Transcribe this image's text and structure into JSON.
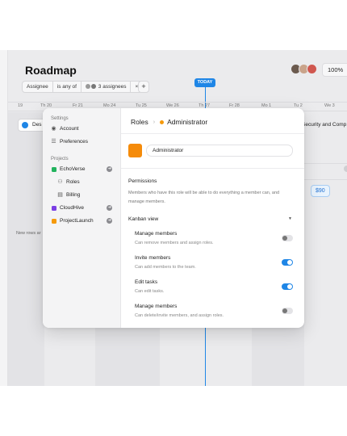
{
  "app": {
    "title": "Roadmap",
    "zoom": "100%",
    "filter": {
      "field": "Assignee",
      "operator": "is any of",
      "value": "3 assignees",
      "clear": "×"
    },
    "add_filter": "+",
    "today_label": "TODAY",
    "days": [
      "19",
      "Th 20",
      "Fr 21",
      "Mo 24",
      "Tu 25",
      "We 26",
      "Th 27",
      "Fr 28",
      "Mo 1",
      "Tu 2",
      "We 3"
    ],
    "task_left": "Des",
    "task_right": "Security and Comp",
    "price": "$90",
    "add_row": "+",
    "new_rows_note": "New rows ar"
  },
  "modal": {
    "settings_header": "Settings",
    "account": "Account",
    "preferences": "Preferences",
    "projects_header": "Projects",
    "projects": [
      {
        "name": "EchoVerse",
        "color": "#22b35e"
      },
      {
        "name": "CloudHive",
        "color": "#7b3fe4"
      },
      {
        "name": "ProjectLaunch",
        "color": "#f59a0c"
      }
    ],
    "roles": "Roles",
    "billing": "Billing",
    "breadcrumb": {
      "parent": "Roles",
      "current": "Administrator"
    },
    "role_color": "#f58b0a",
    "role_name": "Administrator",
    "permissions_title": "Permissions",
    "permissions_desc": "Members who have this role will be able to do everything a member can, and manage members.",
    "group": "Kanban view",
    "items": [
      {
        "title": "Manage members",
        "desc": "Can remove members and assign roles.",
        "enabled": false
      },
      {
        "title": "Invite members",
        "desc": "Can add members to the team.",
        "enabled": true
      },
      {
        "title": "Edit tasks",
        "desc": "Can edit tasks.",
        "enabled": true
      },
      {
        "title": "Manage members",
        "desc": "Can delete/invite members, and assign roles.",
        "enabled": false
      }
    ]
  },
  "colors": {
    "accent": "#1f86e6",
    "orange": "#f58b0a"
  }
}
